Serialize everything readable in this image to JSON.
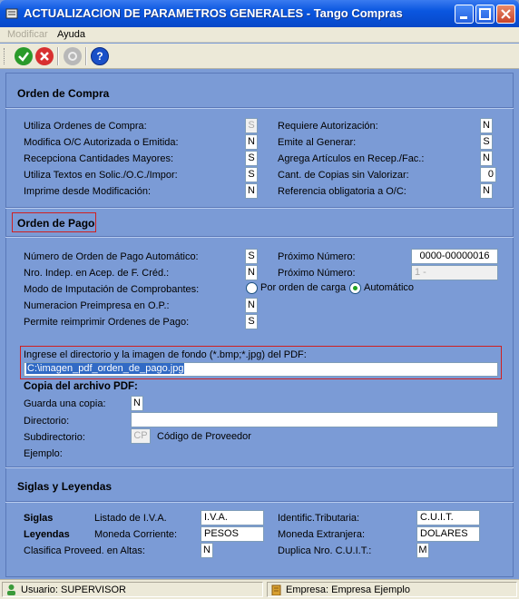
{
  "window": {
    "title": "ACTUALIZACION DE PARAMETROS GENERALES - Tango Compras"
  },
  "menu": {
    "modificar": "Modificar",
    "ayuda": "Ayuda"
  },
  "sections": {
    "orden_compra": "Orden de Compra",
    "orden_pago": "Orden de Pago",
    "siglas": "Siglas y Leyendas"
  },
  "orden_compra": {
    "left": [
      {
        "label": "Utiliza Ordenes de Compra:",
        "value": "S",
        "disabled": true
      },
      {
        "label": "Modifica O/C Autorizada o Emitida:",
        "value": "N"
      },
      {
        "label": "Recepciona Cantidades Mayores:",
        "value": "S"
      },
      {
        "label": "Utiliza Textos en Solic./O.C./Impor:",
        "value": "S"
      },
      {
        "label": "Imprime desde Modificación:",
        "value": "N"
      }
    ],
    "right": [
      {
        "label": "Requiere Autorización:",
        "value": "N"
      },
      {
        "label": "Emite al Generar:",
        "value": "S"
      },
      {
        "label": "Agrega Artículos en Recep./Fac.:",
        "value": "N"
      },
      {
        "label": "Cant. de Copias sin Valorizar:",
        "value": "0"
      },
      {
        "label": "Referencia obligatoria a O/C:",
        "value": "N"
      }
    ]
  },
  "orden_pago": {
    "numero_auto_label": "Número de Orden de Pago Automático:",
    "numero_auto_value": "S",
    "nro_indep_label": "Nro. Indep. en Acep. de F. Créd.:",
    "nro_indep_value": "N",
    "modo_imput_label": "Modo de Imputación de Comprobantes:",
    "numeracion_label": "Numeracion Preimpresa en O.P.:",
    "numeracion_value": "N",
    "reimprimir_label": "Permite reimprimir Ordenes de Pago:",
    "reimprimir_value": "S",
    "proximo1_label": "Próximo Número:",
    "proximo1_value": "0000-00000016",
    "proximo2_label": "Próximo Número:",
    "proximo2_value": "1  -",
    "radio_carga": "Por orden de carga",
    "radio_auto": "Automático",
    "pdf_label": "Ingrese el directorio y la imagen de fondo (*.bmp;*.jpg) del PDF:",
    "pdf_value": "C:\\imagen_pdf_orden_de_pago.jpg",
    "copia_title": "Copia del archivo PDF:",
    "guarda_label": "Guarda una copia:",
    "guarda_value": "N",
    "directorio_label": "Directorio:",
    "subdir_label": "Subdirectorio:",
    "subdir_value": "CP",
    "codigo_prov": "Código de Proveedor",
    "ejemplo_label": "Ejemplo:"
  },
  "siglas": {
    "siglas_label": "Siglas",
    "leyendas_label": "Leyendas",
    "listado_iva_label": "Listado de I.V.A.",
    "listado_iva_value": "I.V.A.",
    "identif_label": "Identific.Tributaria:",
    "identif_value": "C.U.I.T.",
    "moneda_corr_label": "Moneda Corriente:",
    "moneda_corr_value": "PESOS",
    "moneda_ext_label": "Moneda Extranjera:",
    "moneda_ext_value": "DOLARES",
    "clasifica_label": "Clasifica Proveed. en Altas:",
    "clasifica_value": "N",
    "duplica_label": "Duplica Nro. C.U.I.T.:",
    "duplica_value": "M"
  },
  "status": {
    "usuario": "Usuario: SUPERVISOR",
    "empresa": "Empresa: Empresa Ejemplo"
  }
}
